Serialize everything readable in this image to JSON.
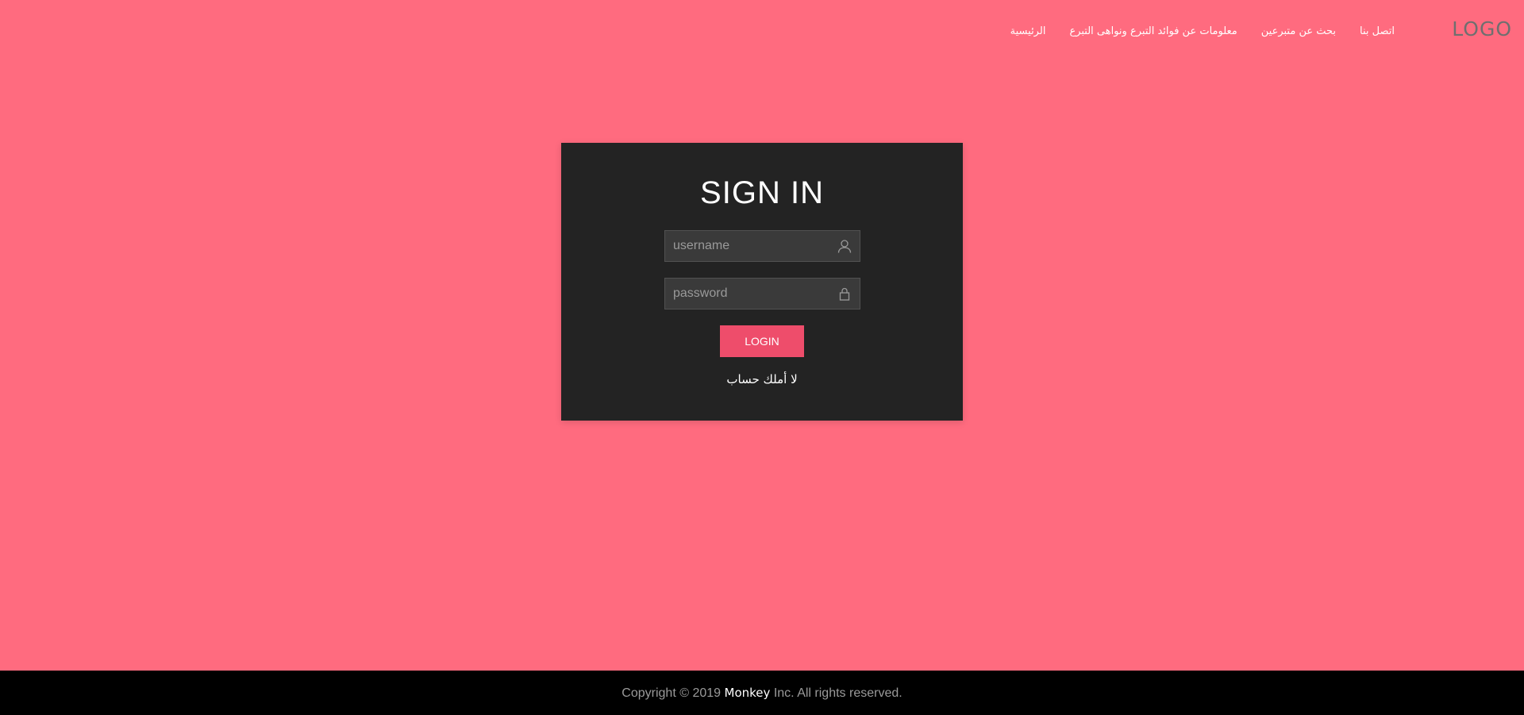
{
  "colors": {
    "background": "#ff6b7f",
    "panel": "#232323",
    "accent": "#ee4d6b",
    "footer": "#000000",
    "logo": "#6f6f6f"
  },
  "header": {
    "logo": "LOGO",
    "nav": [
      {
        "label": "الرئيسية"
      },
      {
        "label": "معلومات عن فوائد التبرع ونواهى التبرع"
      },
      {
        "label": "بحث عن متبرعين"
      },
      {
        "label": "اتصل بنا"
      }
    ]
  },
  "login": {
    "title": "SIGN IN",
    "username_placeholder": "username",
    "username_icon": "user-icon",
    "password_placeholder": "password",
    "password_icon": "lock-icon",
    "button_label": "LOGIN",
    "signup_link": "لا أملك حساب"
  },
  "footer": {
    "prefix": "Copyright © 2019 ",
    "brand": "Monkey",
    "suffix": " Inc. All rights reserved."
  }
}
